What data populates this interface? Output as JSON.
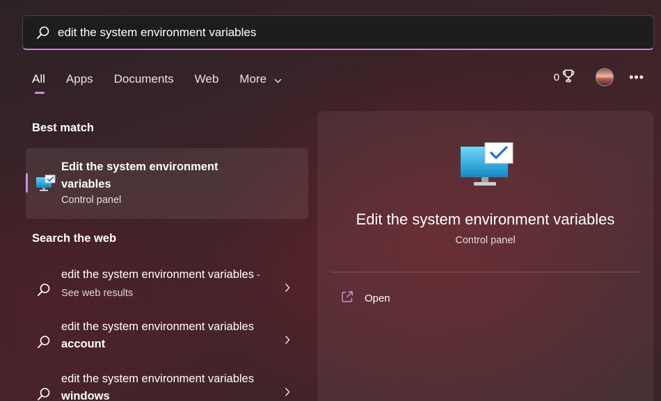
{
  "search": {
    "value": "edit the system environment variables"
  },
  "tabs": [
    {
      "label": "All",
      "active": true
    },
    {
      "label": "Apps"
    },
    {
      "label": "Documents"
    },
    {
      "label": "Web"
    },
    {
      "label": "More"
    }
  ],
  "header": {
    "points": "0"
  },
  "best_match": {
    "section_title": "Best match",
    "title": "Edit the system environment variables",
    "subtitle": "Control panel"
  },
  "web": {
    "section_title": "Search the web",
    "items": [
      {
        "prefix": "edit the system environment variables",
        "suffix_bold": "",
        "hint": " - See web results"
      },
      {
        "prefix": "edit the system environment variables",
        "suffix_bold": " account",
        "hint": ""
      },
      {
        "prefix": "edit the system environment variables",
        "suffix_bold": " windows",
        "hint": ""
      }
    ]
  },
  "detail": {
    "title": "Edit the system environment variables",
    "subtitle": "Control panel",
    "actions": [
      {
        "label": "Open"
      }
    ]
  },
  "colors": {
    "accent": "#d28fd2",
    "search_underline": "#c98bc9"
  }
}
